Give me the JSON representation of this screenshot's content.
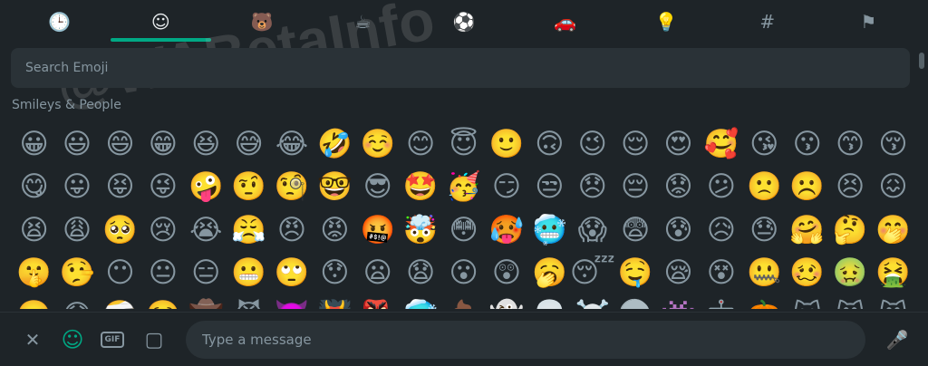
{
  "categories": [
    {
      "name": "recent",
      "glyph": "🕒",
      "active": false
    },
    {
      "name": "smileys",
      "glyph": "☺",
      "active": true
    },
    {
      "name": "animals",
      "glyph": "🐻",
      "active": false
    },
    {
      "name": "food",
      "glyph": "☕",
      "active": false
    },
    {
      "name": "activity",
      "glyph": "⚽",
      "active": false
    },
    {
      "name": "travel",
      "glyph": "🚗",
      "active": false
    },
    {
      "name": "objects",
      "glyph": "💡",
      "active": false
    },
    {
      "name": "symbols",
      "glyph": "#",
      "active": false
    },
    {
      "name": "flags",
      "glyph": "⚑",
      "active": false
    }
  ],
  "search": {
    "placeholder": "Search Emoji"
  },
  "section_title": "Smileys & People",
  "emojis": [
    "😀",
    "😃",
    "😄",
    "😁",
    "😆",
    "😅",
    "😂",
    "🤣",
    "☺️",
    "😊",
    "😇",
    "🙂",
    "🙃",
    "😉",
    "😌",
    "😍",
    "🥰",
    "😘",
    "😗",
    "😙",
    "😚",
    "😋",
    "😛",
    "😝",
    "😜",
    "🤪",
    "🤨",
    "🧐",
    "🤓",
    "😎",
    "🤩",
    "🥳",
    "😏",
    "😒",
    "😞",
    "😔",
    "😟",
    "😕",
    "🙁",
    "☹️",
    "😣",
    "😖",
    "😫",
    "😩",
    "🥺",
    "😢",
    "😭",
    "😤",
    "😠",
    "😡",
    "🤬",
    "🤯",
    "😳",
    "🥵",
    "🥶",
    "😱",
    "😨",
    "😰",
    "😥",
    "😓",
    "🤗",
    "🤔",
    "🤭",
    "🤫",
    "🤥",
    "😶",
    "😐",
    "😑",
    "😬",
    "🙄",
    "😯",
    "😦",
    "😧",
    "😮",
    "😲",
    "🥱",
    "😴",
    "🤤",
    "😪",
    "😵",
    "🤐",
    "🥴",
    "🤢",
    "🤮",
    "🤧",
    "😷",
    "🤕",
    "🤒",
    "🤠",
    "😈",
    "👿",
    "👹",
    "👺",
    "🥶",
    "💩",
    "👻",
    "💀",
    "☠️",
    "👽",
    "👾",
    "🤖",
    "🎃",
    "😺",
    "😸",
    "😹"
  ],
  "watermark": "@WABetaInfo",
  "bottom": {
    "close_glyph": "✕",
    "emoji_glyph": "☺",
    "gif_label": "GIF",
    "sticker_glyph": "▢",
    "message_placeholder": "Type a message",
    "mic_glyph": "🎤"
  }
}
